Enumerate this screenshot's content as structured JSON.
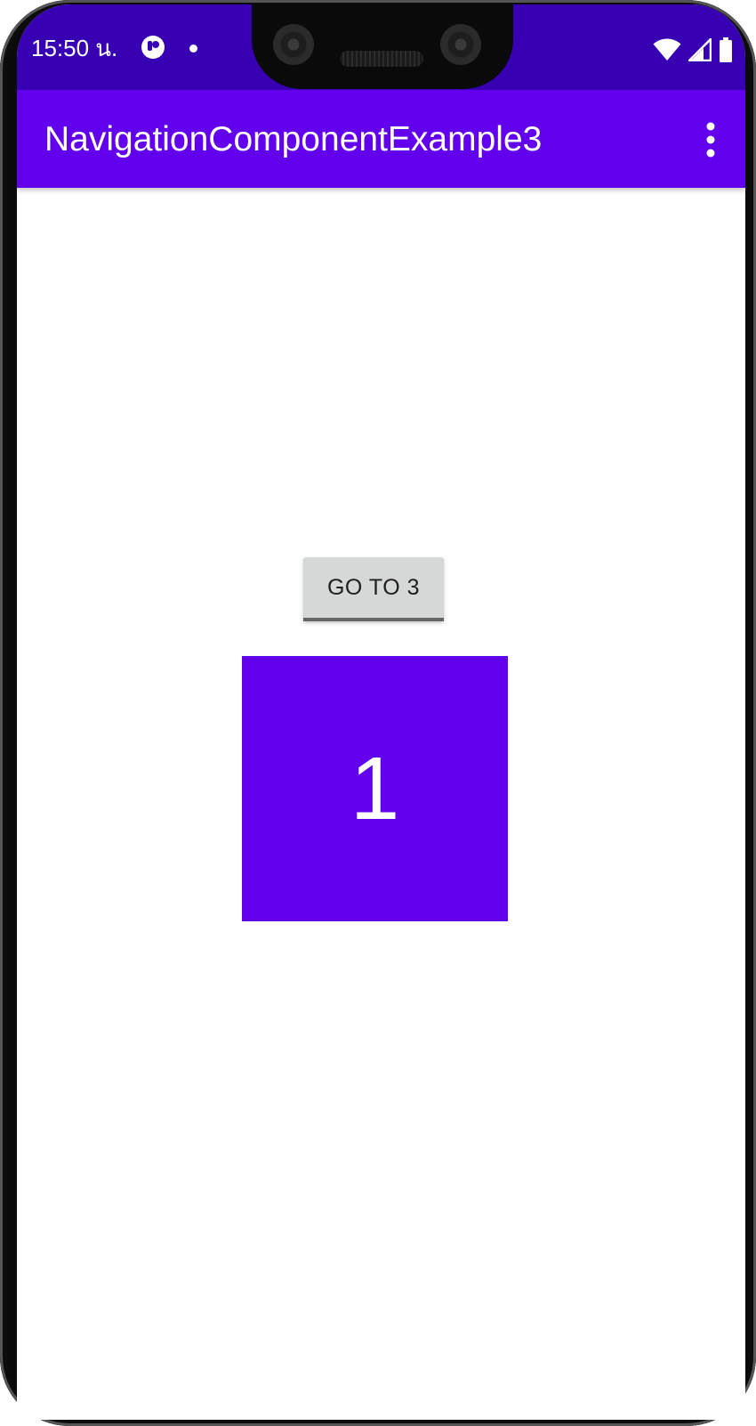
{
  "status_bar": {
    "time": "15:50 น.",
    "app_icon": "circle-app-icon",
    "notification_icon": "dot-icon",
    "wifi_icon": "wifi-icon",
    "signal_icon": "cell-signal-icon",
    "battery_icon": "battery-icon",
    "color": "#3700b3"
  },
  "app_bar": {
    "title": "NavigationComponentExample3",
    "menu_icon": "more-vert-icon",
    "color": "#6200ee"
  },
  "content": {
    "button_label": "GO TO 3",
    "box_number": "1",
    "box_color": "#6200ee"
  }
}
